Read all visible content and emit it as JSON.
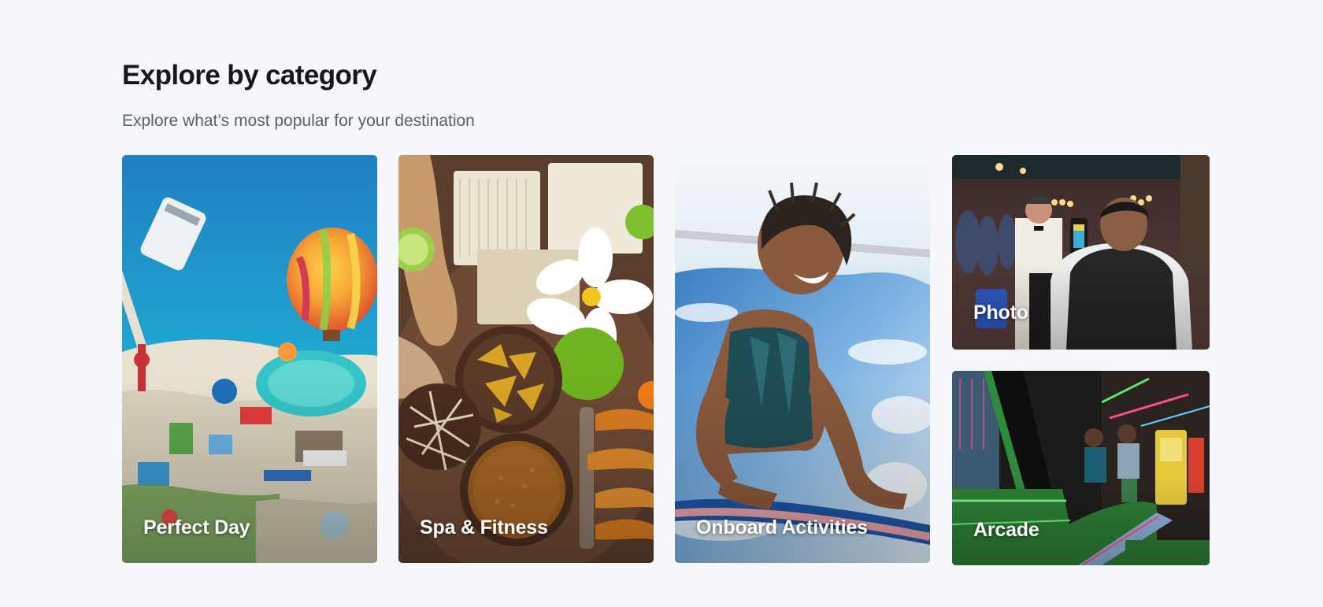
{
  "section": {
    "title": "Explore by category",
    "subtitle": "Explore what’s most popular for your destination"
  },
  "categories": [
    {
      "label": "Perfect Day",
      "image_icon": "island-balloon-image"
    },
    {
      "label": "Spa & Fitness",
      "image_icon": "spa-ingredients-image"
    },
    {
      "label": "Onboard Activities",
      "image_icon": "surf-rider-image"
    },
    {
      "label": "Photo",
      "image_icon": "photographer-image"
    },
    {
      "label": "Arcade",
      "image_icon": "arcade-image"
    }
  ],
  "colors": {
    "page_background": "#f6f7fa",
    "title_text": "#15171a",
    "subtitle_text": "#5b5f66",
    "card_label_text": "#ffffff"
  }
}
